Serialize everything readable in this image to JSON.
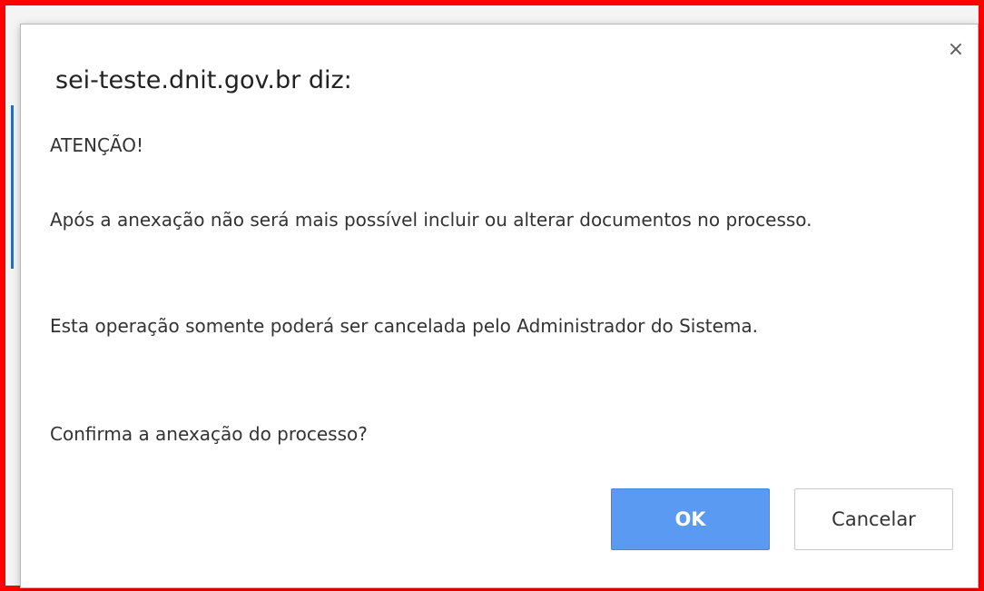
{
  "dialog": {
    "title": "sei-teste.dnit.gov.br diz:",
    "close_glyph": "×",
    "close_icon": "close-icon",
    "messages": [
      "ATENÇÃO!",
      "Após a anexação não será mais possível incluir ou alterar documentos no processo.",
      "Esta operação somente poderá ser cancelada pelo Administrador do Sistema.",
      "Confirma a anexação do processo?"
    ],
    "ok_label": "OK",
    "cancel_label": "Cancelar"
  },
  "colors": {
    "highlight_border": "#ff0000",
    "ok_button": "#5b9af2"
  }
}
